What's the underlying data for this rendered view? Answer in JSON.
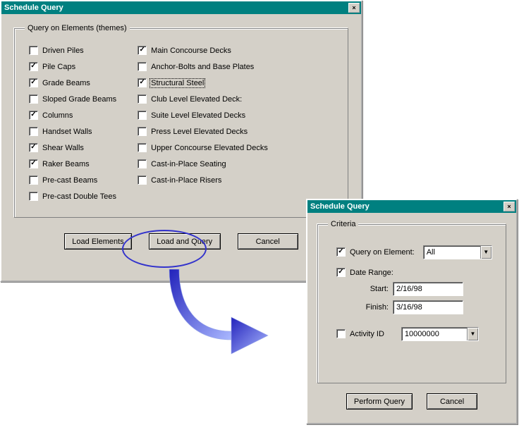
{
  "window1": {
    "title": "Schedule Query",
    "groupTitle": "Query on Elements (themes)",
    "col1": [
      {
        "label": "Driven Piles",
        "checked": false
      },
      {
        "label": "Pile Caps",
        "checked": true
      },
      {
        "label": "Grade Beams",
        "checked": true
      },
      {
        "label": "Sloped Grade Beams",
        "checked": false
      },
      {
        "label": "Columns",
        "checked": true
      },
      {
        "label": "Handset Walls",
        "checked": false
      },
      {
        "label": "Shear Walls",
        "checked": true
      },
      {
        "label": "Raker Beams",
        "checked": true
      },
      {
        "label": "Pre-cast Beams",
        "checked": false
      },
      {
        "label": "Pre-cast Double Tees",
        "checked": false
      }
    ],
    "col2": [
      {
        "label": "Main Concourse Decks",
        "checked": true
      },
      {
        "label": "Anchor-Bolts and Base Plates",
        "checked": false
      },
      {
        "label": "Structural Steel",
        "checked": true,
        "focused": true
      },
      {
        "label": "Club Level Elevated Deck:",
        "checked": false
      },
      {
        "label": "Suite Level Elevated Decks",
        "checked": false
      },
      {
        "label": "Press Level Elevated Decks",
        "checked": false
      },
      {
        "label": "Upper Concourse Elevated Decks",
        "checked": false
      },
      {
        "label": "Cast-in-Place Seating",
        "checked": false
      },
      {
        "label": "Cast-in-Place Risers",
        "checked": false
      }
    ],
    "buttons": {
      "loadElements": "Load Elements",
      "loadAndQuery": "Load and Query",
      "cancel": "Cancel"
    }
  },
  "window2": {
    "title": "Schedule Query",
    "groupTitle": "Criteria",
    "queryOnElement": {
      "checked": true,
      "label": "Query on Element:",
      "value": "All"
    },
    "dateRange": {
      "checked": true,
      "label": "Date Range:",
      "startLabel": "Start:",
      "startValue": "2/16/98",
      "finishLabel": "Finish:",
      "finishValue": "3/16/98"
    },
    "activityId": {
      "checked": false,
      "label": "Activity ID",
      "value": "10000000"
    },
    "buttons": {
      "performQuery": "Perform Query",
      "cancel": "Cancel"
    }
  }
}
